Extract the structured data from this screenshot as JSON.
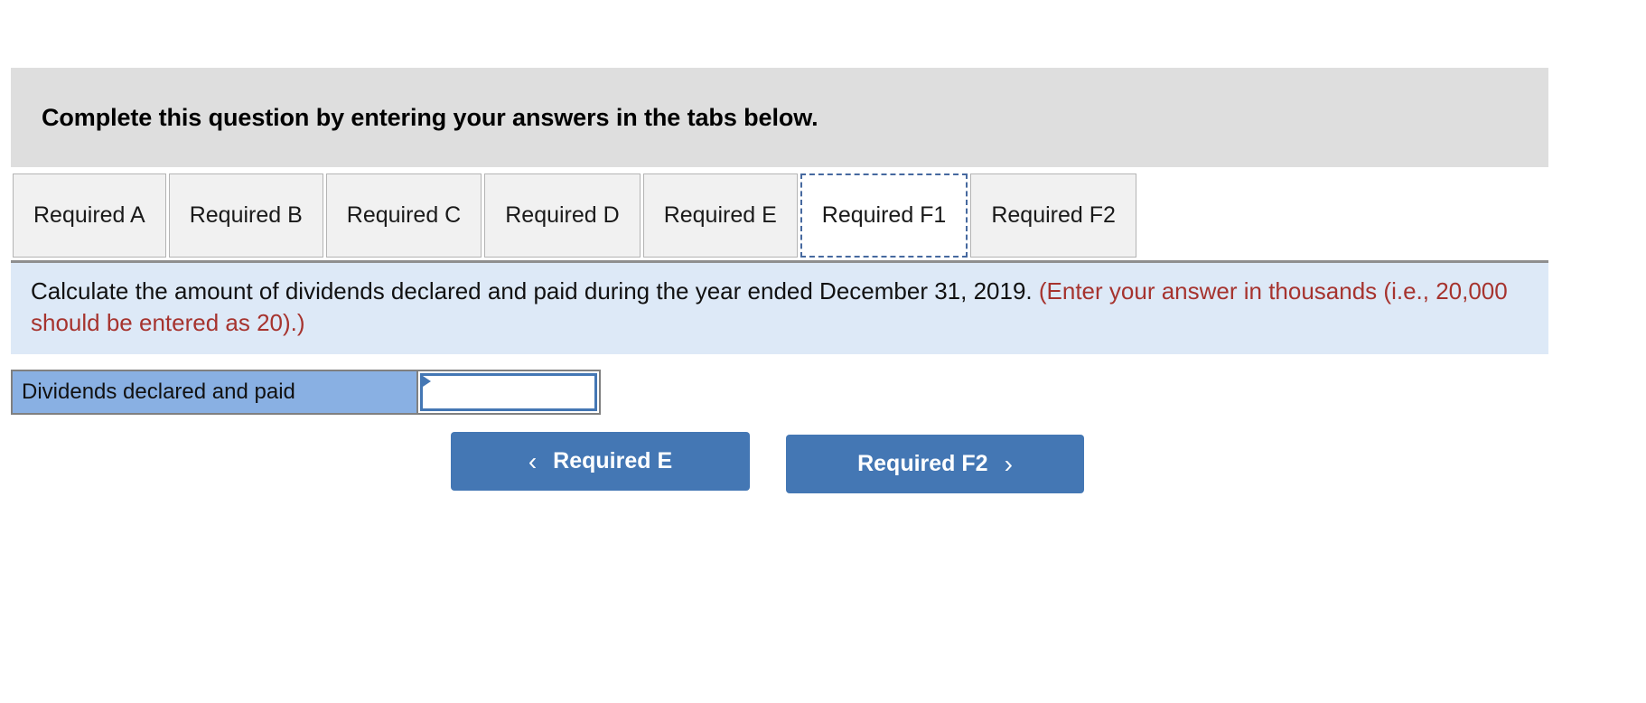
{
  "banner": {
    "text": "Complete this question by entering your answers in the tabs below."
  },
  "tabs": [
    {
      "label": "Required A",
      "active": false
    },
    {
      "label": "Required B",
      "active": false
    },
    {
      "label": "Required C",
      "active": false
    },
    {
      "label": "Required D",
      "active": false
    },
    {
      "label": "Required E",
      "active": false
    },
    {
      "label": "Required F1",
      "active": true
    },
    {
      "label": "Required F2",
      "active": false
    }
  ],
  "question": {
    "main": "Calculate the amount of dividends declared and paid during the year ended December 31, 2019.",
    "note": "(Enter your answer in thousands (i.e., 20,000 should be entered as 20).)"
  },
  "answer_table": {
    "rows": [
      {
        "label": "Dividends declared and paid",
        "value": "",
        "placeholder": ""
      }
    ]
  },
  "navigation": {
    "prev": {
      "label": "Required E",
      "icon": "chevron-left-icon",
      "glyph": "‹"
    },
    "next": {
      "label": "Required F2",
      "icon": "chevron-right-icon",
      "glyph": "›"
    }
  },
  "colors": {
    "banner_bg": "#dedede",
    "panel_bg": "#dde9f7",
    "note_red": "#a6332e",
    "label_blue": "#89b0e3",
    "button_blue": "#4477b4",
    "tab_inactive_bg": "#f1f1f1",
    "focus_outline": "#46699f"
  }
}
